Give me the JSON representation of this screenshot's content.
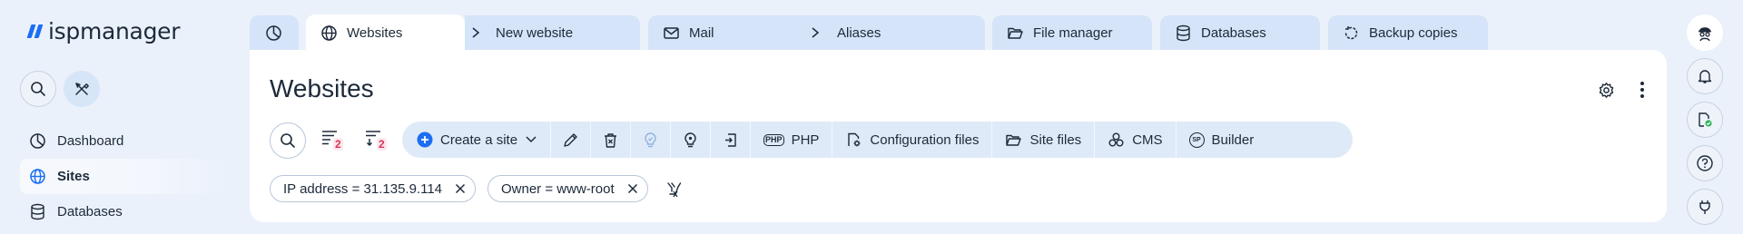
{
  "brand": {
    "name": "ispmanager",
    "accent": "#1c6df2"
  },
  "sidebar": {
    "tools": [
      {
        "icon": "search-icon"
      },
      {
        "icon": "tools-icon"
      }
    ],
    "items": [
      {
        "label": "Dashboard",
        "icon": "dashboard-icon"
      },
      {
        "label": "Sites",
        "icon": "globe-icon",
        "active": true
      },
      {
        "label": "Databases",
        "icon": "database-icon"
      }
    ]
  },
  "tabs": [
    {
      "icon": "dashboard-icon",
      "label": ""
    },
    {
      "icon": "globe-icon",
      "label": "Websites",
      "active": true,
      "child": "New website"
    },
    {
      "icon": "mail-icon",
      "label": "Mail",
      "child": "Aliases"
    },
    {
      "icon": "folder-icon",
      "label": "File manager"
    },
    {
      "icon": "database-icon",
      "label": "Databases"
    },
    {
      "icon": "backup-icon",
      "label": "Backup copies"
    }
  ],
  "page": {
    "title": "Websites"
  },
  "filters": {
    "badge_one": "2",
    "badge_two": "2"
  },
  "toolbar": {
    "create_label": "Create a site",
    "php_label": "PHP",
    "config_label": "Configuration files",
    "site_files_label": "Site files",
    "cms_label": "CMS",
    "builder_label": "Builder",
    "php_icon_text": "PHP",
    "builder_icon_text": "SP"
  },
  "chips": [
    {
      "label": "IP address = 31.135.9.114"
    },
    {
      "label": "Owner = www-root"
    }
  ],
  "right_rail": [
    {
      "icon": "user-avatar-icon"
    },
    {
      "icon": "bell-icon"
    },
    {
      "icon": "license-icon"
    },
    {
      "icon": "help-icon"
    },
    {
      "icon": "plug-icon"
    }
  ],
  "colors": {
    "background": "#eaf1fb",
    "tab": "#d5e4f8",
    "toolbar": "#dfeaf9",
    "accent": "#1c6df2",
    "badge": "#d9345a",
    "success": "#2fb45a"
  }
}
